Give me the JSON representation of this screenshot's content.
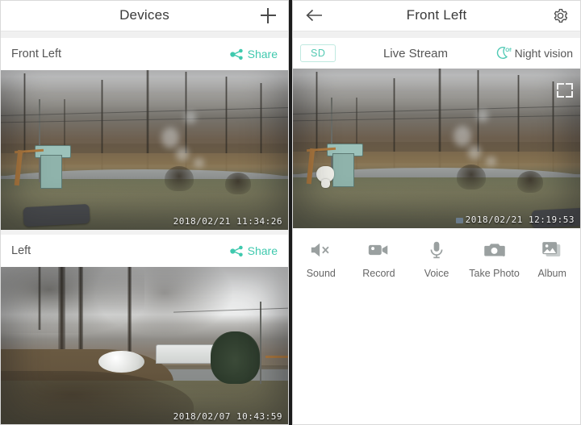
{
  "left_panel": {
    "navbar": {
      "title": "Devices",
      "add_icon": "plus-icon"
    },
    "cards": [
      {
        "name": "Front Left",
        "share_label": "Share",
        "share_icon": "share-icon",
        "timestamp": "2018/02/21  11:34:26"
      },
      {
        "name": "Left",
        "share_label": "Share",
        "share_icon": "share-icon",
        "timestamp": "2018/02/07  10:43:59"
      }
    ]
  },
  "right_panel": {
    "navbar": {
      "title": "Front Left",
      "back_icon": "arrow-left-icon",
      "settings_icon": "gear-icon"
    },
    "substrip": {
      "quality_badge": "SD",
      "stream_label": "Live Stream",
      "night_vision_label": "Night vision",
      "night_vision_icon": "moon-off-icon",
      "night_vision_state": "Off"
    },
    "stream": {
      "timestamp": "2018/02/21  12:19:53",
      "fullscreen_icon": "fullscreen-icon"
    },
    "toolbar": [
      {
        "label": "Sound",
        "icon": "speaker-mute-icon"
      },
      {
        "label": "Record",
        "icon": "video-camera-icon"
      },
      {
        "label": "Voice",
        "icon": "microphone-icon"
      },
      {
        "label": "Take Photo",
        "icon": "camera-icon"
      },
      {
        "label": "Album",
        "icon": "photo-album-icon"
      }
    ]
  },
  "colors": {
    "accent_teal": "#3fc9ae",
    "badge_teal": "#52c9b2",
    "nav_text": "#3a3a3a",
    "body_text": "#555555",
    "icon_gray": "#9aa0a0",
    "divider": "#1c1c1c"
  }
}
